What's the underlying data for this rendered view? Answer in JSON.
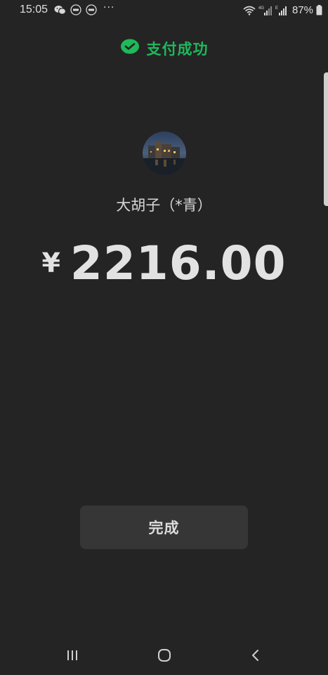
{
  "status_bar": {
    "time": "15:05",
    "battery_percent": "87%",
    "left_icons": [
      "wechat-icon",
      "idm-icon",
      "idm-icon"
    ],
    "more": "···",
    "right_icons": [
      "wifi-icon",
      "4g-signal-icon",
      "e-signal-icon",
      "battery-icon"
    ],
    "network_labels": [
      "4G",
      "E"
    ]
  },
  "header": {
    "success_text": "支付成功",
    "icon": "wechat-pay-check-icon",
    "accent_color": "#1fb85a"
  },
  "payee": {
    "name": "大胡子（*青）",
    "avatar": "avatar-photo"
  },
  "payment": {
    "currency_symbol": "¥",
    "amount": "2216.00"
  },
  "actions": {
    "done_label": "完成"
  },
  "nav_bar": {
    "recent_icon": "recent-apps-icon",
    "home_icon": "home-icon",
    "back_icon": "back-icon"
  },
  "colors": {
    "background": "#242424",
    "button_bg": "#363636",
    "text": "#e2e2e2"
  }
}
